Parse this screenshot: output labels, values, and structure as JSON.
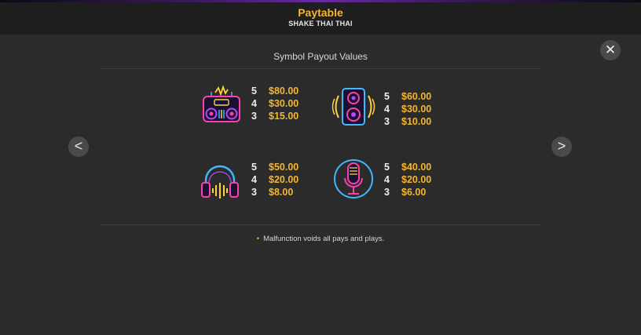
{
  "header": {
    "title": "Paytable",
    "subtitle": "SHAKE THAI THAI"
  },
  "controls": {
    "close_glyph": "✕",
    "prev_glyph": "<",
    "next_glyph": ">"
  },
  "section": {
    "title": "Symbol Payout Values"
  },
  "symbols": [
    {
      "icon": "boombox-icon",
      "payouts": [
        {
          "count": "5",
          "value": "$80.00"
        },
        {
          "count": "4",
          "value": "$30.00"
        },
        {
          "count": "3",
          "value": "$15.00"
        }
      ]
    },
    {
      "icon": "speaker-icon",
      "payouts": [
        {
          "count": "5",
          "value": "$60.00"
        },
        {
          "count": "4",
          "value": "$30.00"
        },
        {
          "count": "3",
          "value": "$10.00"
        }
      ]
    },
    {
      "icon": "headphones-icon",
      "payouts": [
        {
          "count": "5",
          "value": "$50.00"
        },
        {
          "count": "4",
          "value": "$20.00"
        },
        {
          "count": "3",
          "value": "$8.00"
        }
      ]
    },
    {
      "icon": "microphone-icon",
      "payouts": [
        {
          "count": "5",
          "value": "$40.00"
        },
        {
          "count": "4",
          "value": "$20.00"
        },
        {
          "count": "3",
          "value": "$6.00"
        }
      ]
    }
  ],
  "note": {
    "bullet": "•",
    "text": "Malfunction voids all pays and plays."
  },
  "colors": {
    "accent": "#f5b531",
    "neon_pink": "#ff3fae",
    "neon_blue": "#3fb8ff",
    "neon_yellow": "#ffd23f",
    "neon_purple": "#b04cff"
  }
}
